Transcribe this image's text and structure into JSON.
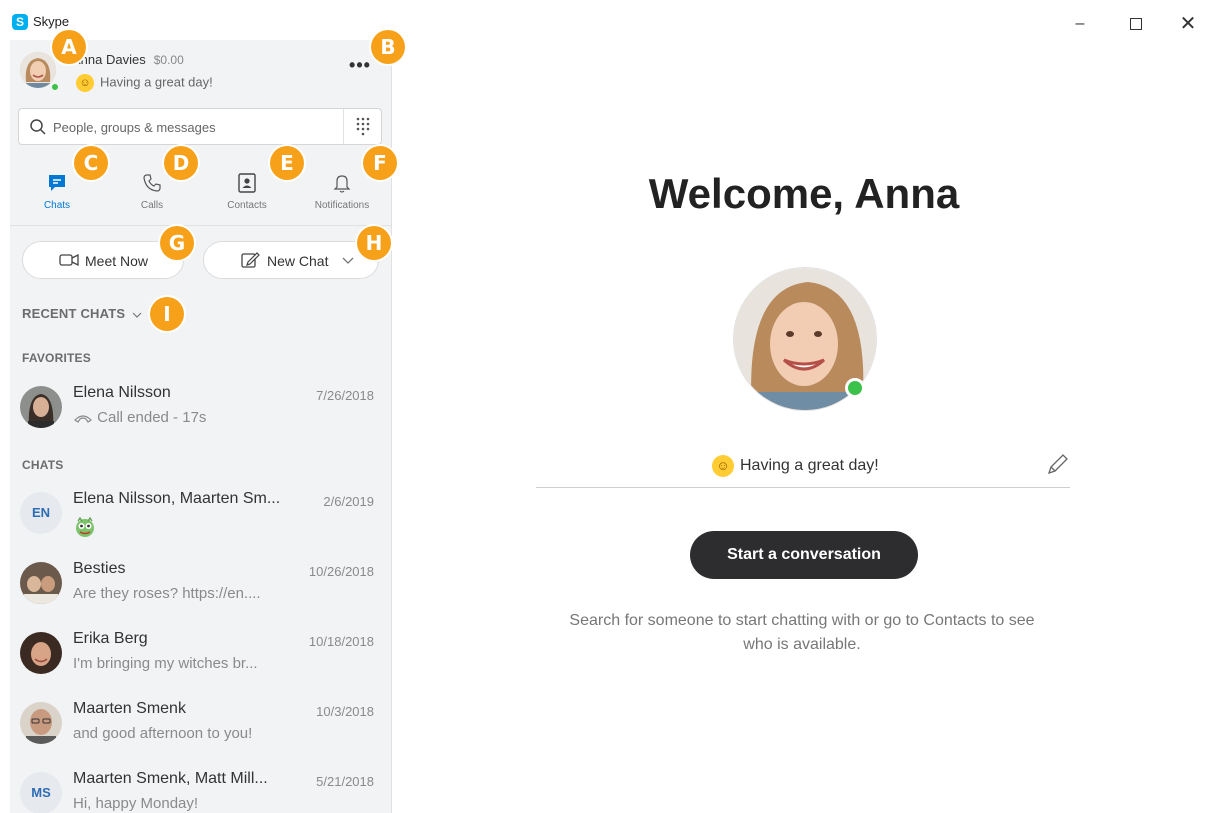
{
  "window": {
    "title": "Skype",
    "logo_letter": "S",
    "minimize_label": "–",
    "close_label": "✕"
  },
  "profile": {
    "name": "Anna Davies",
    "credit": "$0.00",
    "mood": "Having a great day!",
    "more_label": "•••"
  },
  "search": {
    "placeholder": "People, groups & messages"
  },
  "tabs": [
    {
      "label": "Chats",
      "icon": "chat-icon"
    },
    {
      "label": "Calls",
      "icon": "phone-icon"
    },
    {
      "label": "Contacts",
      "icon": "contacts-icon"
    },
    {
      "label": "Notifications",
      "icon": "bell-icon"
    }
  ],
  "actions": {
    "meet_now": "Meet Now",
    "new_chat": "New Chat"
  },
  "sections": {
    "recent": "RECENT CHATS",
    "favorites": "FAVORITES",
    "chats": "CHATS"
  },
  "favorites": [
    {
      "name": "Elena Nilsson",
      "date": "7/26/2018",
      "preview": "Call ended - 17s"
    }
  ],
  "chats": [
    {
      "name": "Elena Nilsson, Maarten Sm...",
      "date": "2/6/2019",
      "preview": "",
      "initials": "EN"
    },
    {
      "name": "Besties",
      "date": "10/26/2018",
      "preview": "Are they roses?  https://en...."
    },
    {
      "name": "Erika Berg",
      "date": "10/18/2018",
      "preview": "I'm bringing my witches br..."
    },
    {
      "name": "Maarten Smenk",
      "date": "10/3/2018",
      "preview": "and good afternoon to you!"
    },
    {
      "name": "Maarten Smenk, Matt Mill...",
      "date": "5/21/2018",
      "preview": "Hi, happy Monday!",
      "initials": "MS"
    }
  ],
  "markers": [
    "A",
    "B",
    "C",
    "D",
    "E",
    "F",
    "G",
    "H",
    "I"
  ],
  "main": {
    "welcome": "Welcome, Anna",
    "mood": "Having a great day!",
    "start_button": "Start a conversation",
    "hint": "Search for someone to start chatting with or go to Contacts to see who is available."
  },
  "colors": {
    "accent": "#0078d4",
    "presence": "#3cc14b",
    "marker": "#f7a11a",
    "start_button": "#2d2d2f"
  }
}
